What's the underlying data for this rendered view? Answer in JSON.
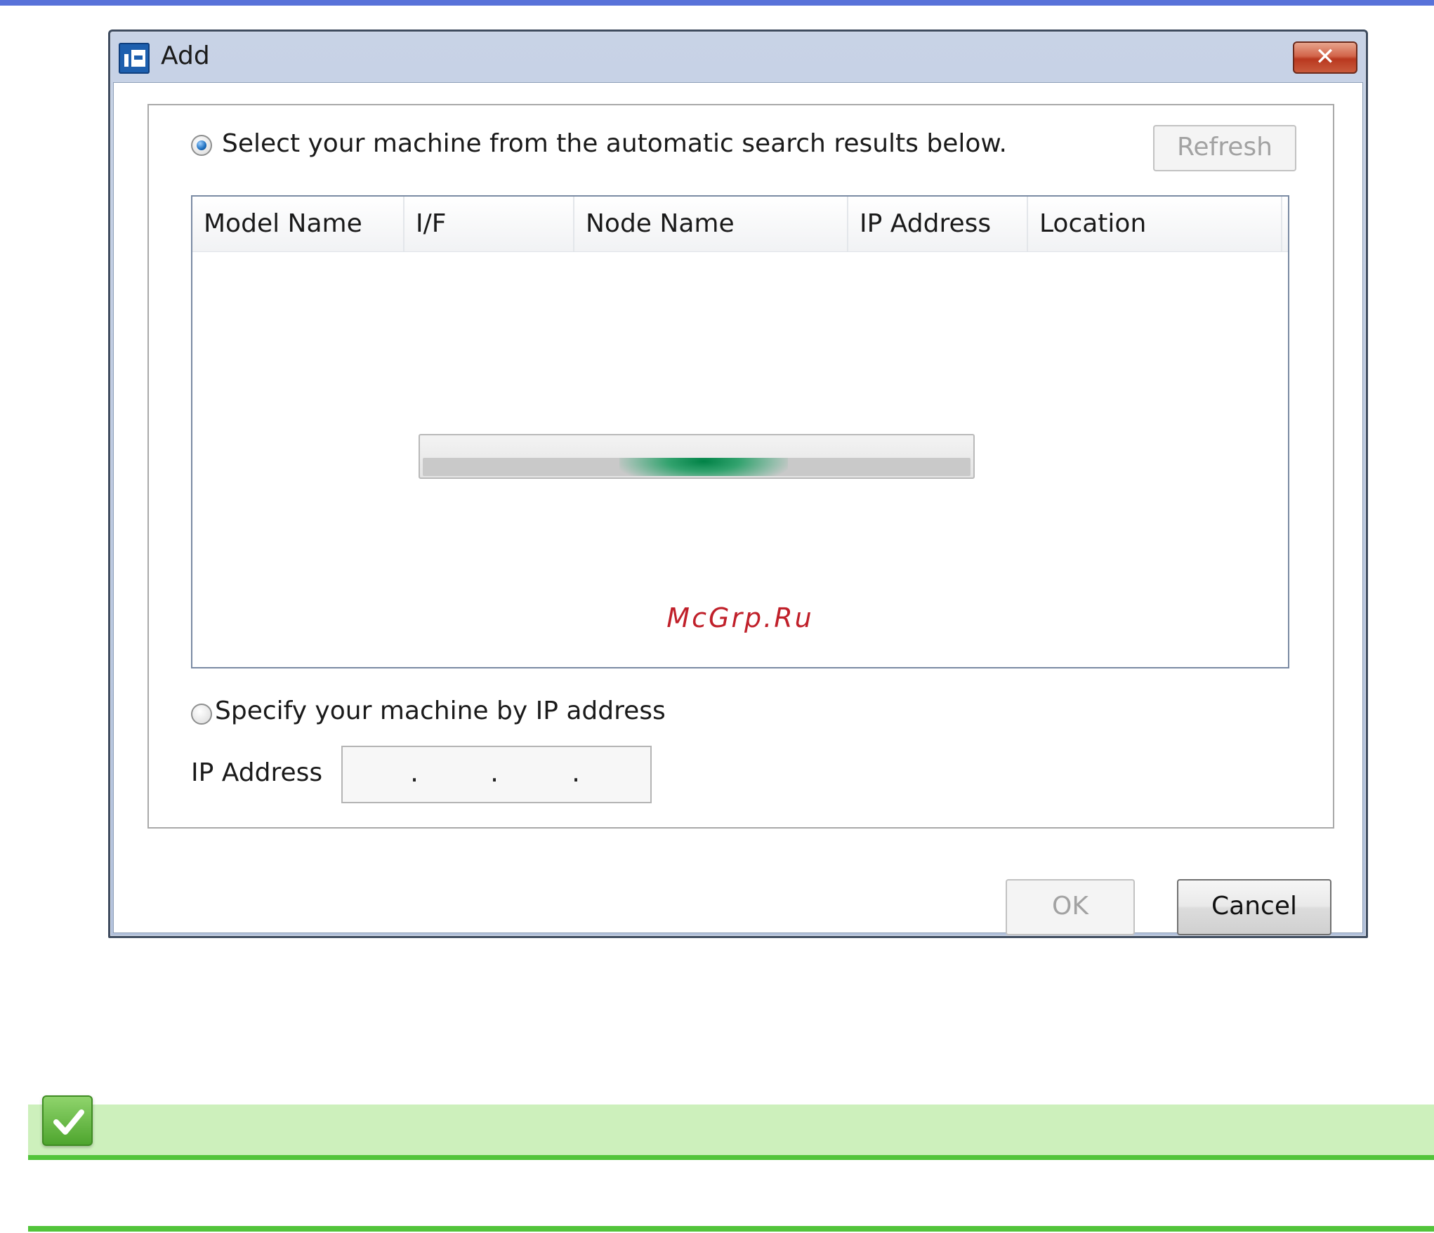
{
  "window": {
    "title": "Add",
    "close_label": "✕"
  },
  "search_option": {
    "label": "Select your machine from the automatic search results  below.",
    "selected": true,
    "refresh_label": "Refresh"
  },
  "results_table": {
    "columns": [
      "Model Name",
      "I/F",
      "Node Name",
      "IP Address",
      "Location"
    ],
    "rows": []
  },
  "watermark": "McGrp.Ru",
  "ip_option": {
    "label": "Specify your machine by IP address",
    "selected": false,
    "field_label": "IP Address",
    "separator": "."
  },
  "footer": {
    "ok_label": "OK",
    "cancel_label": "Cancel"
  },
  "icons": {
    "app": "printer-add-icon",
    "close": "close-icon",
    "note": "checkmark-icon"
  },
  "colors": {
    "accent": "#5872d9",
    "progress": "#008a48",
    "note_background": "#cdf0bc",
    "note_line": "#52c43a",
    "watermark": "#c0202a"
  }
}
